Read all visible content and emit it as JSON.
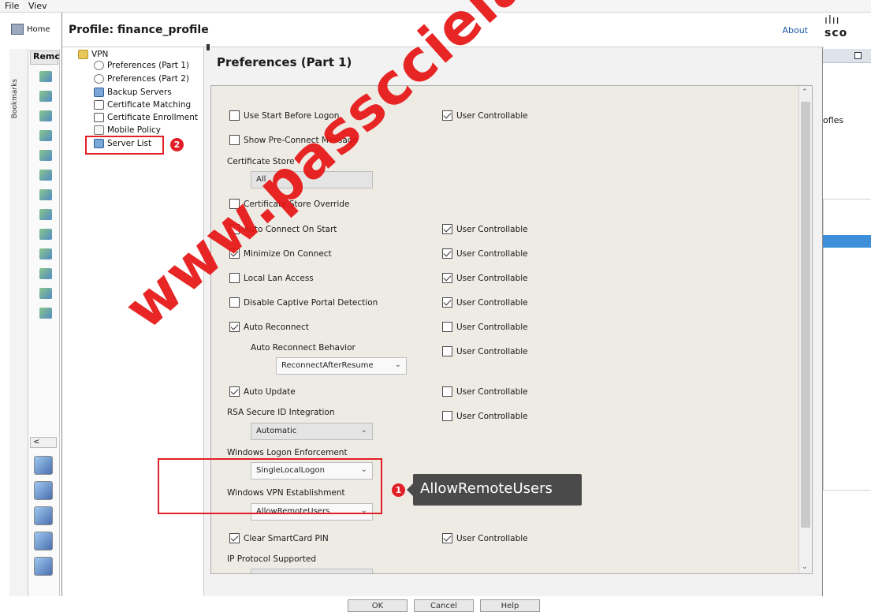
{
  "background_app": {
    "menu_file": "File",
    "menu_view": "Viev",
    "home_label": "Home",
    "tab_label": "Remc",
    "bookmarks_label": "Bookmarks",
    "right_text": "ofles",
    "scroll_left": "<",
    "logo_bars": "ılıı",
    "logo_text": "sco"
  },
  "dialog": {
    "title": "Profile: finance_profile",
    "about": "About"
  },
  "tree": {
    "root": "VPN",
    "items": [
      {
        "label": "Preferences (Part 1)",
        "icon": "gear-icon"
      },
      {
        "label": "Preferences (Part 2)",
        "icon": "gear-icon"
      },
      {
        "label": "Backup Servers",
        "icon": "server-icon"
      },
      {
        "label": "Certificate Matching",
        "icon": "certificate-icon"
      },
      {
        "label": "Certificate Enrollment",
        "icon": "certificate-icon"
      },
      {
        "label": "Mobile Policy",
        "icon": "document-icon"
      },
      {
        "label": "Server List",
        "icon": "server-list-icon"
      }
    ]
  },
  "content": {
    "title": "Preferences (Part 1)",
    "use_start_before_logon": "Use Start Before Logon",
    "show_preconnect": "Show Pre-Connect Message",
    "certificate_store_label": "Certificate Store",
    "certificate_store_value": "All",
    "certificate_store_override": "Certificate Store Override",
    "auto_connect_on_start": "Auto Connect On Start",
    "minimize_on_connect": "Minimize On Connect",
    "local_lan_access": "Local Lan Access",
    "disable_captive_portal": "Disable Captive Portal Detection",
    "auto_reconnect": "Auto Reconnect",
    "auto_reconnect_behavior_label": "Auto Reconnect Behavior",
    "auto_reconnect_behavior_value": "ReconnectAfterResume",
    "auto_update": "Auto Update",
    "rsa_label": "RSA Secure ID Integration",
    "rsa_value": "Automatic",
    "windows_logon_label": "Windows Logon Enforcement",
    "windows_logon_value": "SingleLocalLogon",
    "windows_vpn_label": "Windows VPN Establishment",
    "windows_vpn_value": "AllowRemoteUsers",
    "clear_smartcard": "Clear SmartCard PIN",
    "ip_protocol_label": "IP Protocol Supported",
    "user_controllable": "User Controllable"
  },
  "annotations": {
    "badge_1": "1",
    "badge_2": "2",
    "callout_text": "AllowRemoteUsers",
    "accent_color": "#e21f26"
  },
  "buttons": {
    "ok": "OK",
    "cancel": "Cancel",
    "help": "Help"
  },
  "watermark": "www.passcciela"
}
